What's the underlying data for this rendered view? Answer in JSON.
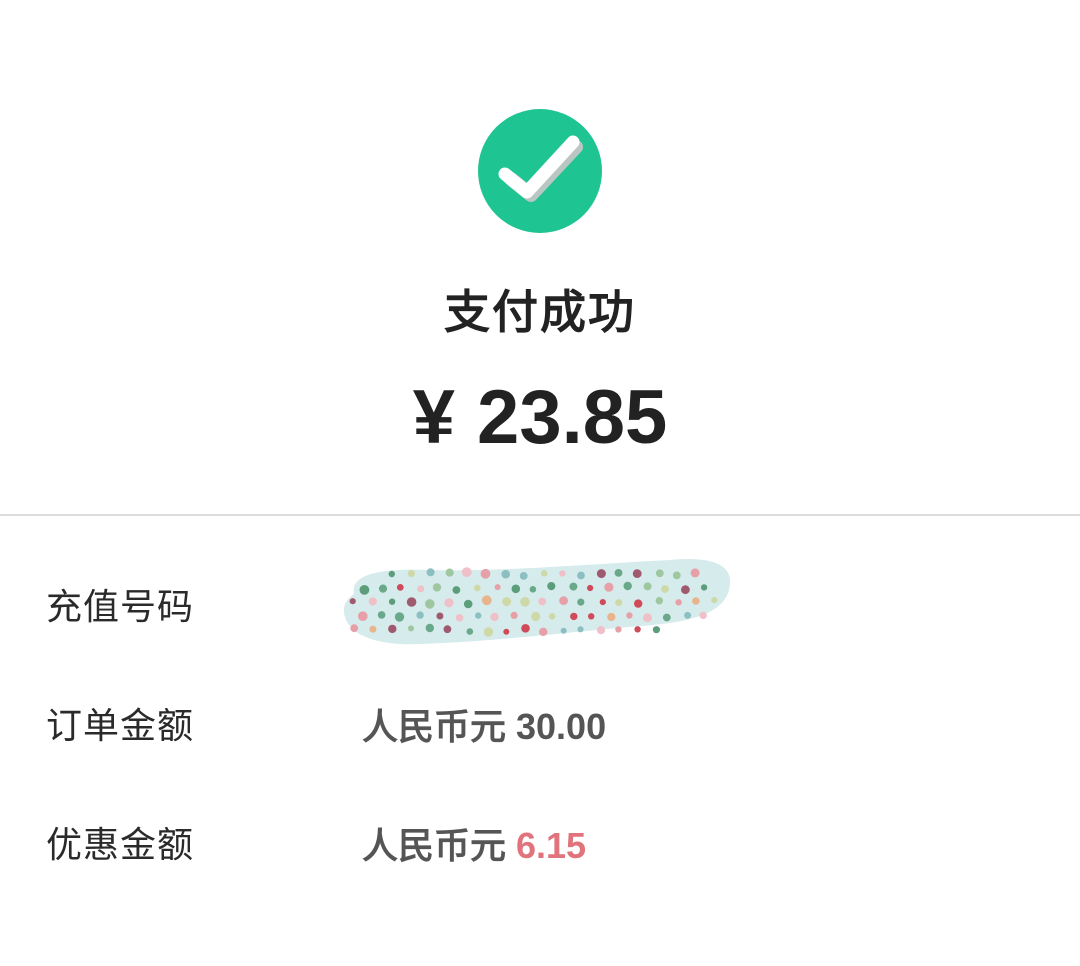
{
  "status": {
    "icon": "check-circle-icon",
    "title": "支付成功",
    "accent_color": "#1fc493"
  },
  "payment": {
    "currency_symbol": "¥",
    "amount": "23.85"
  },
  "details": [
    {
      "label": "充值号码",
      "value": "",
      "redacted": true
    },
    {
      "label": "订单金额",
      "unit": "人民币元",
      "number": "30.00"
    },
    {
      "label": "优惠金额",
      "unit": "人民币元",
      "number": "6.15",
      "number_color": "#e0737b"
    }
  ]
}
